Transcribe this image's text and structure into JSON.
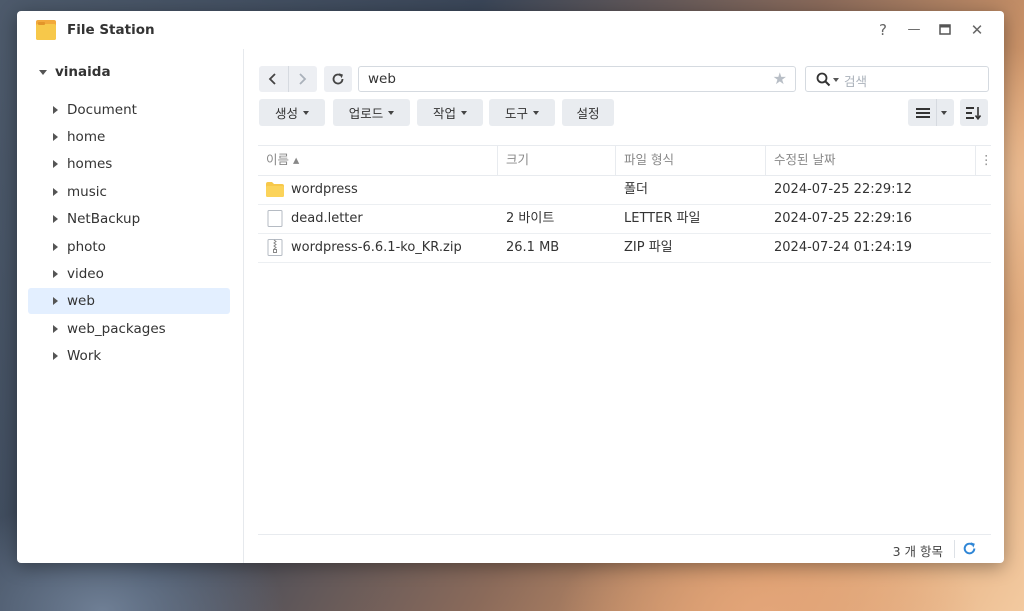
{
  "window": {
    "title": "File Station"
  },
  "window_controls": {
    "help": "?",
    "minimize": "—",
    "maximize": "▭",
    "close": "✕"
  },
  "sidebar": {
    "root": "vinaida",
    "items": [
      {
        "label": "Document"
      },
      {
        "label": "home"
      },
      {
        "label": "homes"
      },
      {
        "label": "music"
      },
      {
        "label": "NetBackup"
      },
      {
        "label": "photo"
      },
      {
        "label": "video"
      },
      {
        "label": "web",
        "selected": true
      },
      {
        "label": "web_packages"
      },
      {
        "label": "Work"
      }
    ]
  },
  "toolbar": {
    "path": "web",
    "search_placeholder": "검색",
    "create_label": "생성",
    "upload_label": "업로드",
    "action_label": "작업",
    "tools_label": "도구",
    "settings_label": "설정"
  },
  "table": {
    "columns": [
      "이름 ▴",
      "크기",
      "파일 형식",
      "수정된 날짜"
    ],
    "rows": [
      {
        "name": "wordpress",
        "size": "",
        "type": "폴더",
        "modified": "2024-07-25 22:29:12",
        "icon": "folder-icon"
      },
      {
        "name": "dead.letter",
        "size": "2 바이트",
        "type": "LETTER 파일",
        "modified": "2024-07-25 22:29:16",
        "icon": "file-icon"
      },
      {
        "name": "wordpress-6.6.1-ko_KR.zip",
        "size": "26.1 MB",
        "type": "ZIP 파일",
        "modified": "2024-07-24 01:24:19",
        "icon": "zip-file-icon"
      }
    ]
  },
  "status": {
    "count": "3 개 항목"
  },
  "colors": {
    "accent": "#2f86d6",
    "selected_bg": "#e3efff",
    "folder": "#f7c84a"
  }
}
